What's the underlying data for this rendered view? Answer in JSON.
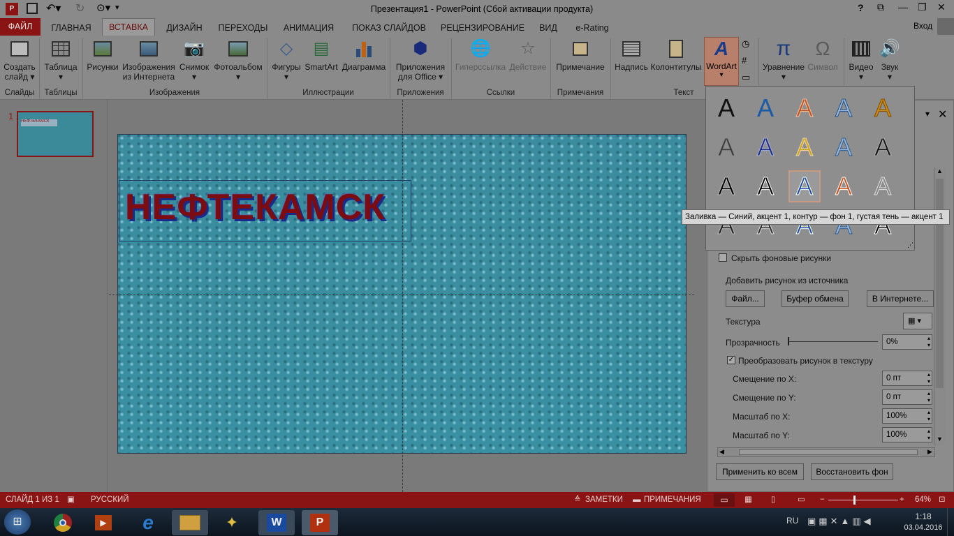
{
  "window": {
    "title": "Презентация1 - PowerPoint (Сбой активации продукта)",
    "controls": {
      "help": "?",
      "ribbon_display": "⧉",
      "minimize": "—",
      "restore": "❐",
      "close": "✕"
    },
    "qat": {
      "app_icon": "powerpoint-icon",
      "save": "save-icon",
      "undo": "undo-icon",
      "redo": "redo-icon",
      "present": "present-icon",
      "customize": "▾"
    }
  },
  "tabs": [
    "ФАЙЛ",
    "ГЛАВНАЯ",
    "ВСТАВКА",
    "ДИЗАЙН",
    "ПЕРЕХОДЫ",
    "АНИМАЦИЯ",
    "ПОКАЗ СЛАЙДОВ",
    "РЕЦЕНЗИРОВАНИЕ",
    "ВИД",
    "e-Rating"
  ],
  "active_tab": "ВСТАВКА",
  "signin": "Вход",
  "ribbon": {
    "groups": {
      "slides": "Слайды",
      "tables": "Таблицы",
      "images": "Изображения",
      "illustrations": "Иллюстрации",
      "apps": "Приложения",
      "links": "Ссылки",
      "comments": "Примечания",
      "text": "Текст"
    },
    "buttons": {
      "new_slide_1": "Создать",
      "new_slide_2": "слайд ▾",
      "table_1": "Таблица",
      "table_2": "▾",
      "pictures": "Рисунки",
      "online_1": "Изображения",
      "online_2": "из Интернета",
      "screenshot_1": "Снимок",
      "screenshot_2": "▾",
      "album_1": "Фотоальбом",
      "album_2": "▾",
      "shapes_1": "Фигуры",
      "shapes_2": "▾",
      "smartart": "SmartArt",
      "chart": "Диаграмма",
      "apps_1": "Приложения",
      "apps_2": "для Office ▾",
      "hyperlink": "Гиперссылка",
      "action": "Действие",
      "comment": "Примечание",
      "textbox": "Надпись",
      "header_footer": "Колонтитулы",
      "wordart_1": "WordArt",
      "wordart_2": "▾",
      "equation_1": "Уравнение",
      "equation_2": "▾",
      "symbol": "Символ",
      "video_1": "Видео",
      "video_2": "▾",
      "audio_1": "Звук",
      "audio_2": "▾"
    }
  },
  "thumbnail": {
    "number": "1",
    "text": "НЕФТЕКАМСК"
  },
  "slide": {
    "title": "НЕФТЕКАМСК"
  },
  "wordart_gallery": {
    "letter": "A",
    "tooltip": "Заливка — Синий, акцент 1, контур — фон 1, густая тень — акцент 1",
    "styles": [
      {
        "fill": "#111111",
        "stroke": "none"
      },
      {
        "fill": "#1b5aa6",
        "stroke": "none"
      },
      {
        "fill": "#c0501c",
        "stroke": "#f3c7a8"
      },
      {
        "fill": "#9ab7d6",
        "stroke": "#1f4e8c"
      },
      {
        "fill": "#d08a10",
        "stroke": "#7a4d00"
      },
      {
        "fill": "#3a3a3a",
        "stroke": "#8a8a8a"
      },
      {
        "fill": "#1a2c8a",
        "stroke": "#aab4d8"
      },
      {
        "fill": "#d4a017",
        "stroke": "#eadbb2"
      },
      {
        "fill": "#9ab7d6",
        "stroke": "#2a5a94"
      },
      {
        "fill": "#151515",
        "stroke": "#aaaaaa"
      },
      {
        "fill": "#000000",
        "stroke": "#bbbbbb"
      },
      {
        "fill": "#000000",
        "stroke": "#ffffff"
      },
      {
        "fill": "#1f4e9e",
        "stroke": "#ffffff"
      },
      {
        "fill": "#c8521d",
        "stroke": "#ffffff"
      },
      {
        "fill": "#888888",
        "stroke": "#e0e0e0"
      },
      {
        "fill": "#222222",
        "stroke": "#bbbbbb"
      },
      {
        "fill": "#333333",
        "stroke": "#dddddd"
      },
      {
        "fill": "#1f4e9e",
        "stroke": "#ffffff"
      },
      {
        "fill": "#9ab7d6",
        "stroke": "#2a5a94"
      },
      {
        "fill": "#111111",
        "stroke": "#ffffff"
      }
    ],
    "selected_index": 12
  },
  "format_pane": {
    "hide_bg_label": "Скрыть фоновые рисунки",
    "hide_bg_checked": false,
    "insert_from_label": "Добавить рисунок из источника",
    "file_btn": "Файл...",
    "clipboard_btn": "Буфер обмена",
    "online_btn": "В Интернете...",
    "texture_label": "Текстура",
    "transparency_label": "Прозрачность",
    "transparency_value": "0%",
    "tile_label": "Преобразовать рисунок в текстуру",
    "tile_checked": true,
    "offset_x_label": "Смещение по X:",
    "offset_x_value": "0 пт",
    "offset_y_label": "Смещение по Y:",
    "offset_y_value": "0 пт",
    "scale_x_label": "Масштаб по X:",
    "scale_x_value": "100%",
    "scale_y_label": "Масштаб по Y:",
    "scale_y_value": "100%",
    "apply_all_btn": "Применить ко всем",
    "reset_bg_btn": "Восстановить фон"
  },
  "status": {
    "slide": "СЛАЙД 1 ИЗ 1",
    "language": "РУССКИЙ",
    "notes": "ЗАМЕТКИ",
    "comments": "ПРИМЕЧАНИЯ",
    "zoom": "64%",
    "zoom_fraction": 0.36
  },
  "taskbar": {
    "apps": [
      "start",
      "chrome",
      "media-player",
      "internet-explorer",
      "file-explorer",
      "wizard",
      "word",
      "powerpoint"
    ],
    "lang": "RU",
    "time": "1:18",
    "date": "03.04.2016"
  }
}
